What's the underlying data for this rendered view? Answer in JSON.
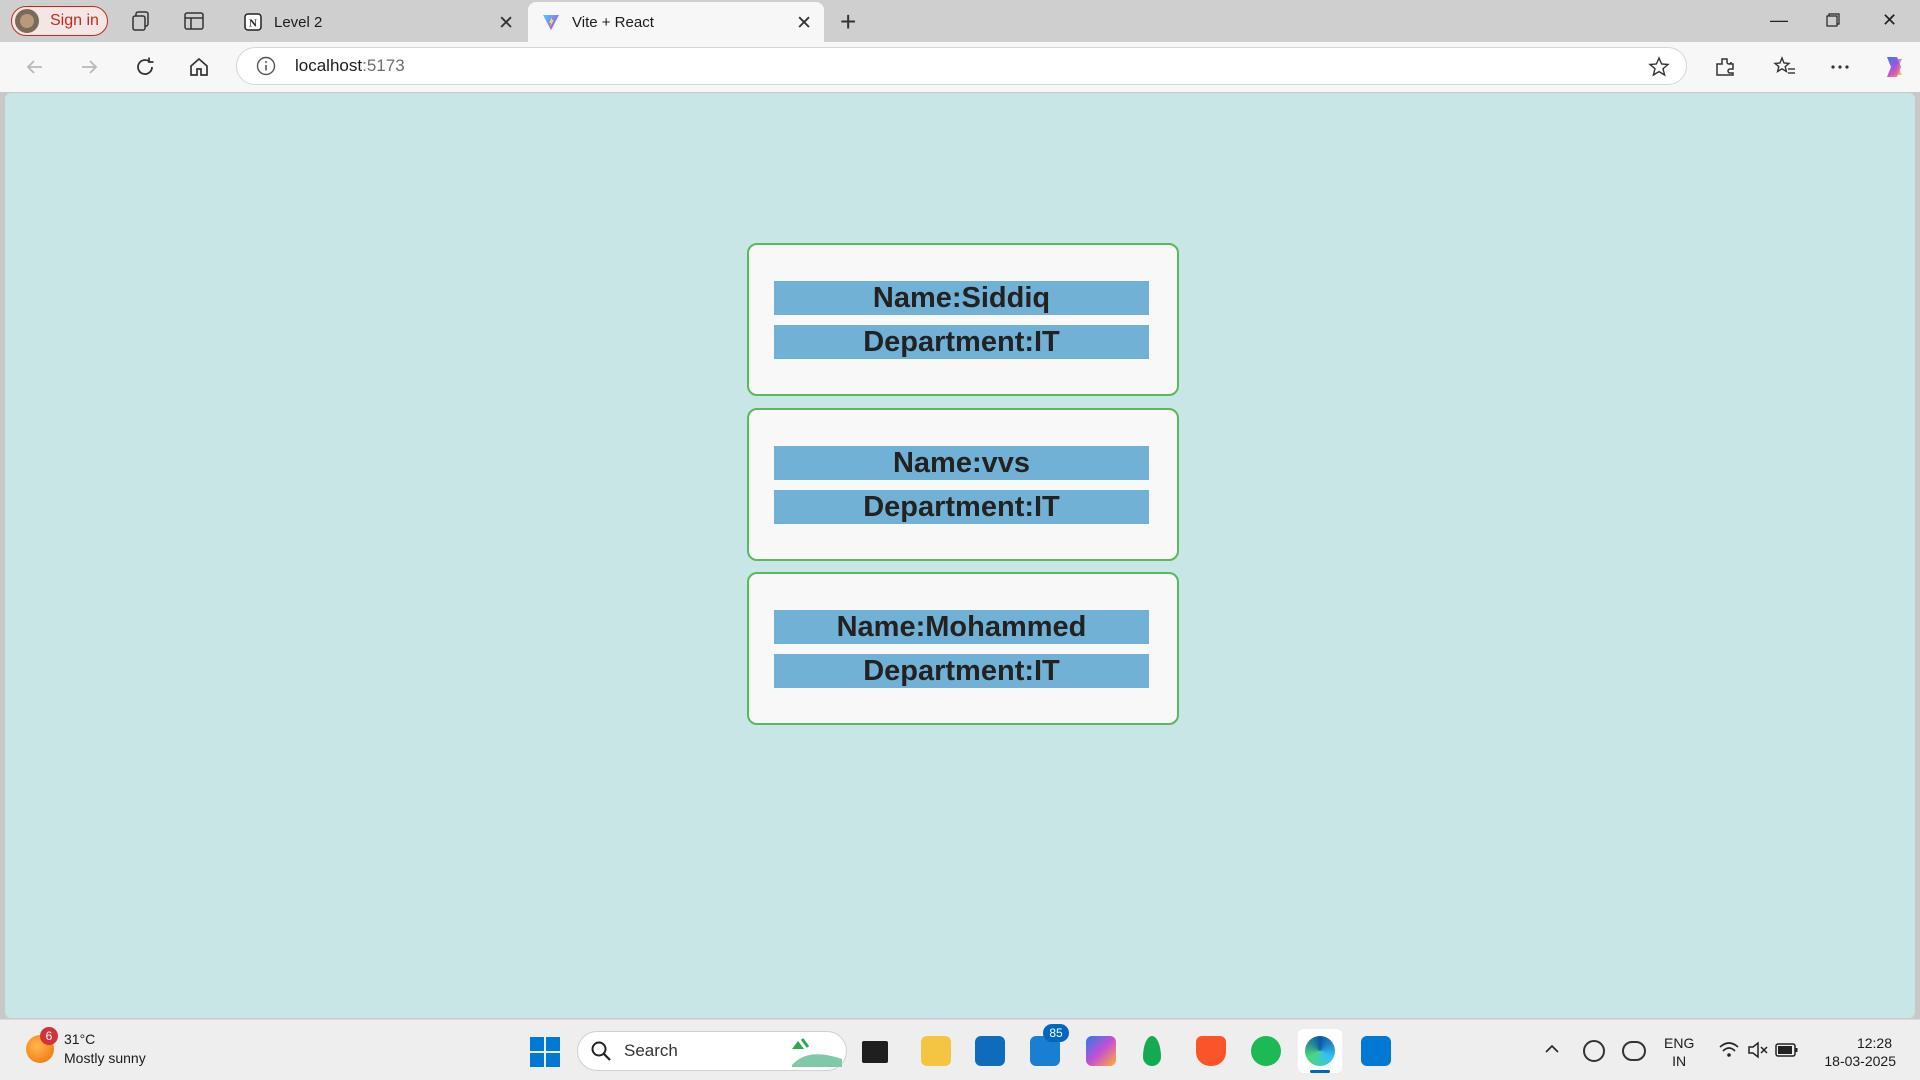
{
  "browser": {
    "signin_label": "Sign in",
    "tabs": [
      {
        "title": "Level 2",
        "icon": "notion-icon"
      },
      {
        "title": "Vite + React",
        "icon": "vite-icon"
      }
    ],
    "url": {
      "host": "localhost",
      "port": ":5173"
    }
  },
  "employees": [
    {
      "name": "Name:Siddiq",
      "department": "Department:IT"
    },
    {
      "name": "Name:vvs",
      "department": "Department:IT"
    },
    {
      "name": "Name:Mohammed",
      "department": "Department:IT"
    }
  ],
  "colors": {
    "page_bg": "#c8e6e5",
    "card_bg": "#f8f8f8",
    "card_border": "#5bb85b",
    "row_bg": "#72b1d6"
  },
  "taskbar": {
    "weather": {
      "badge": "6",
      "temp": "31°C",
      "condition": "Mostly sunny"
    },
    "search_label": "Search",
    "mail_badge": "85",
    "language": {
      "line1": "ENG",
      "line2": "IN"
    },
    "clock": {
      "time": "12:28",
      "date": "18-03-2025"
    }
  }
}
